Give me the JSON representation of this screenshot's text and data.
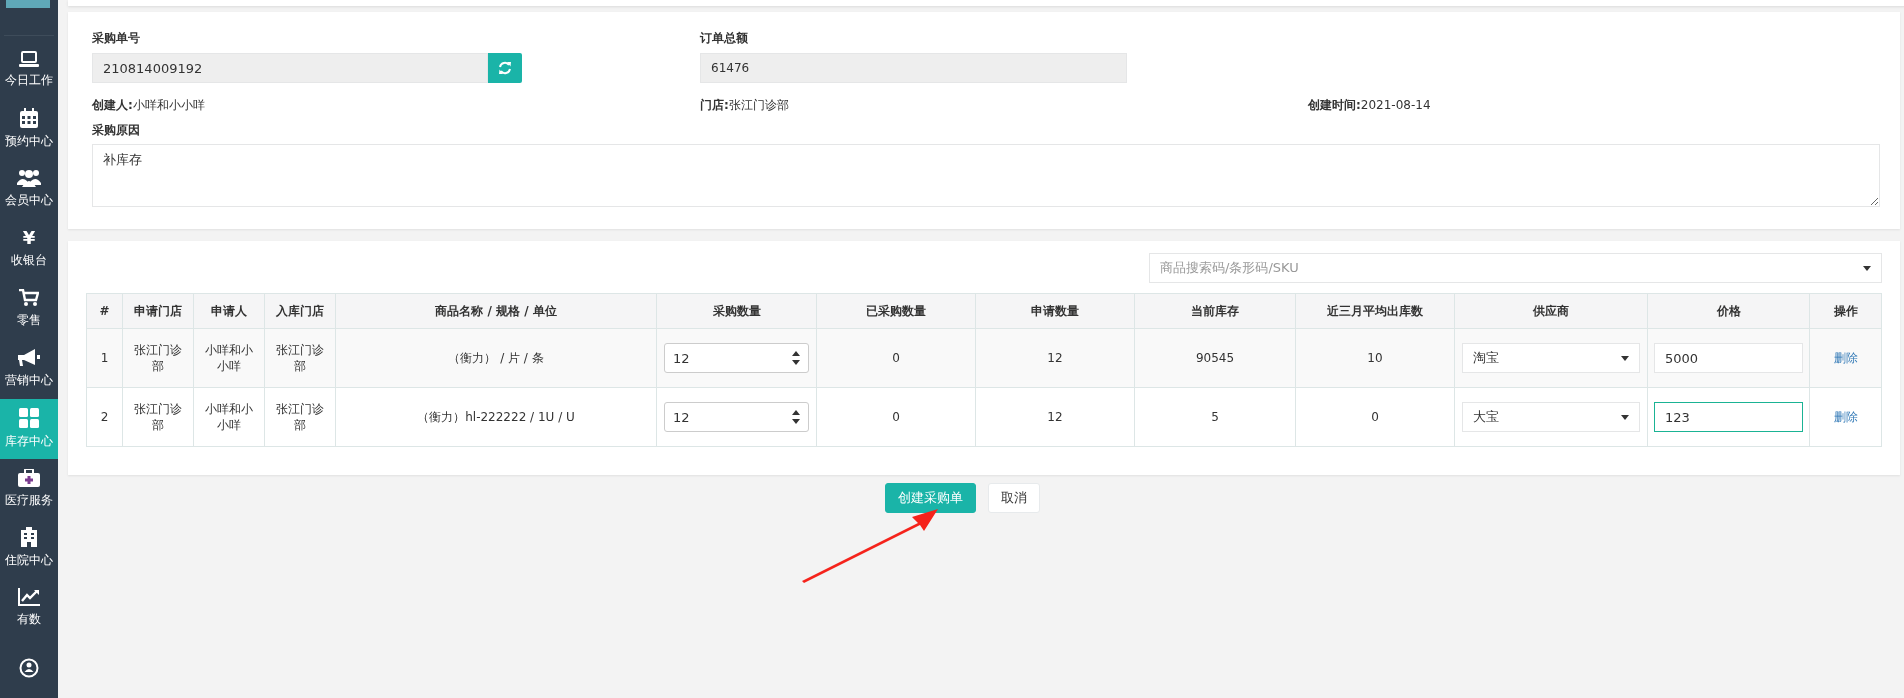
{
  "sidebar": {
    "items": [
      {
        "label": "今日工作",
        "selected": false
      },
      {
        "label": "预约中心",
        "selected": false
      },
      {
        "label": "会员中心",
        "selected": false
      },
      {
        "label": "收银台",
        "icon_char": "¥",
        "selected": false
      },
      {
        "label": "零售",
        "selected": false
      },
      {
        "label": "营销中心",
        "selected": false
      },
      {
        "label": "库存中心",
        "selected": true
      },
      {
        "label": "医疗服务",
        "selected": false
      },
      {
        "label": "住院中心",
        "selected": false
      },
      {
        "label": "有数",
        "selected": false
      },
      {
        "selected": false
      }
    ]
  },
  "order_form": {
    "order_no": {
      "label": "采购单号",
      "value": "210814009192"
    },
    "total": {
      "label": "订单总额",
      "value": "61476"
    },
    "info": [
      "**创建人:**小咩和小小咩",
      "**门店:**张江门诊部",
      "**创建时间:**2021-08-14"
    ],
    "reason": {
      "label": "采购原因",
      "value": "补库存"
    }
  },
  "product_search": {
    "placeholder": "商品搜索码/条形码/SKU"
  },
  "table": {
    "columns": [
      "#",
      "申请门店",
      "申请人",
      "入库门店",
      "商品名称 / 规格 / 单位",
      "采购数量",
      "已采购数量",
      "申请数量",
      "当前库存",
      "近三月平均出库数",
      "供应商",
      "价格",
      "操作"
    ],
    "rows": [
      {
        "index": "1",
        "store": "张江门诊部",
        "applicant": "小咩和小小咩",
        "warehouse": "张江门诊部",
        "product": "（衡力） / 片 / 条",
        "quantity": "12",
        "purchased": "0",
        "requested": "12",
        "stock": "90545",
        "avg_out": "10",
        "supplier": "淘宝",
        "price": "5000",
        "price_focused": false,
        "action": "删除"
      },
      {
        "index": "2",
        "store": "张江门诊部",
        "applicant": "小咩和小小咩",
        "warehouse": "张江门诊部",
        "product": "（衡力）hl-222222 / 1U / U",
        "quantity": "12",
        "purchased": "0",
        "requested": "12",
        "stock": "5",
        "avg_out": "0",
        "supplier": "大宝",
        "price": "123",
        "price_focused": true,
        "action": "删除"
      }
    ]
  },
  "actions": [
    "创建采购单",
    "取消"
  ]
}
